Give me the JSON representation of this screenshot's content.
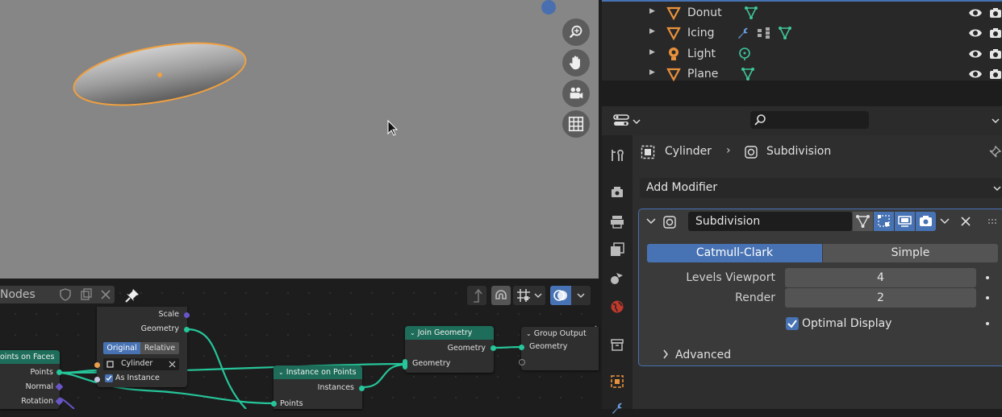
{
  "outliner": {
    "items": [
      {
        "label": "Donut",
        "icon": "mesh-icon"
      },
      {
        "label": "Icing",
        "icon": "mesh-icon"
      },
      {
        "label": "Light",
        "icon": "light-icon"
      },
      {
        "label": "Plane",
        "icon": "mesh-icon"
      }
    ]
  },
  "properties": {
    "breadcrumb_object": "Cylinder",
    "breadcrumb_modifier": "Subdivision",
    "add_modifier": "Add Modifier",
    "modifier": {
      "name": "Subdivision",
      "type_options": [
        "Catmull-Clark",
        "Simple"
      ],
      "selected_type": "Catmull-Clark",
      "levels_viewport_label": "Levels Viewport",
      "levels_viewport_value": "4",
      "render_label": "Render",
      "render_value": "2",
      "optimal_display_label": "Optimal Display",
      "optimal_display_checked": true,
      "advanced_label": "Advanced"
    }
  },
  "node_editor": {
    "header_name": "Nodes",
    "nodes": {
      "points_on_faces": {
        "title": "oints on Faces",
        "outputs": [
          "Points",
          "Normal",
          "Rotation"
        ]
      },
      "object_info": {
        "outputs": [
          "Scale",
          "Geometry"
        ],
        "modes": [
          "Original",
          "Relative"
        ],
        "object": "Cylinder",
        "as_instance": "As Instance"
      },
      "instance_on_points": {
        "title": "Instance on Points",
        "outputs": [
          "Instances"
        ],
        "inputs": [
          "Points"
        ]
      },
      "join_geometry": {
        "title": "Join Geometry",
        "outputs": [
          "Geometry"
        ],
        "inputs": [
          "Geometry"
        ]
      },
      "group_output": {
        "title": "Group Output",
        "inputs": [
          "Geometry"
        ]
      }
    }
  },
  "colors": {
    "accent": "#4772b3",
    "node_header_green": "#1e6d5a",
    "link_teal": "#26c59a",
    "selection_orange": "#e8a04a"
  }
}
